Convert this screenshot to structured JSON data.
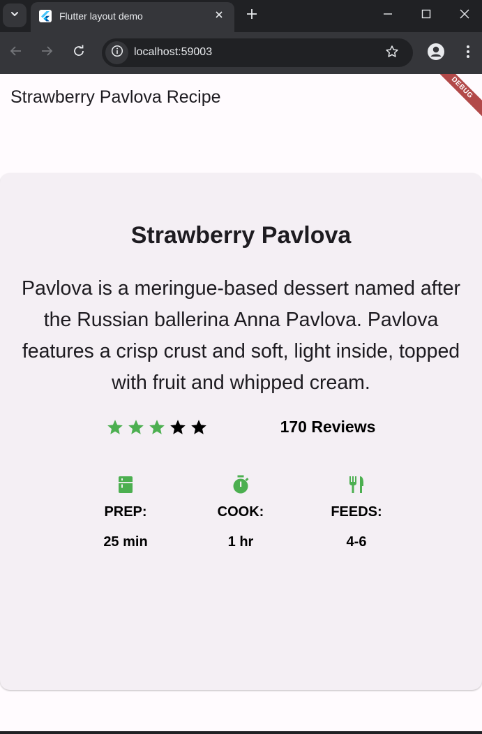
{
  "browser": {
    "tab_title": "Flutter layout demo",
    "url": "localhost:59003",
    "icons": {
      "tab_search": "chevron-down-icon",
      "favicon": "flutter-icon",
      "tab_close": "close-icon",
      "new_tab": "plus-icon",
      "minimize": "minimize-icon",
      "maximize": "maximize-icon",
      "close_window": "close-icon",
      "back": "arrow-left-icon",
      "forward": "arrow-right-icon",
      "reload": "reload-icon",
      "site_info": "info-icon",
      "bookmark": "star-outline-icon",
      "profile": "profile-icon",
      "menu": "kebab-menu-icon"
    }
  },
  "app": {
    "title": "Strawberry Pavlova Recipe",
    "debug_banner": "DEBUG",
    "card": {
      "title": "Strawberry Pavlova",
      "description": "Pavlova is a meringue-based dessert named after the Russian ballerina Anna Pavlova. Pavlova features a crisp crust and soft, light inside, topped with fruit and whipped cream.",
      "rating": {
        "filled_stars": 3,
        "total_stars": 5,
        "filled_color": "#4caf50",
        "empty_color": "#000000"
      },
      "reviews": "170 Reviews",
      "info": [
        {
          "icon": "kitchen-icon",
          "label": "PREP:",
          "value": "25 min"
        },
        {
          "icon": "timer-icon",
          "label": "COOK:",
          "value": "1 hr"
        },
        {
          "icon": "restaurant-icon",
          "label": "FEEDS:",
          "value": "4-6"
        }
      ],
      "accent_color": "#4caf50"
    }
  }
}
